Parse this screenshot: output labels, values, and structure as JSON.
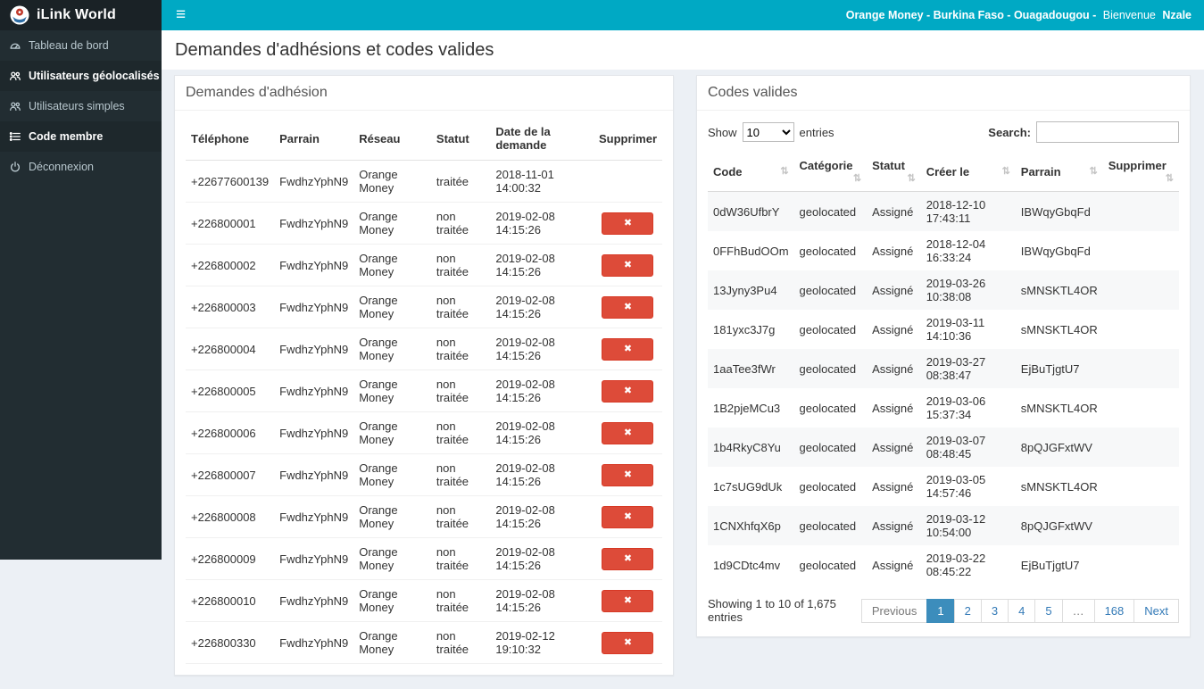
{
  "topbar": {
    "brand": "iLink World",
    "menu_icon": "≡",
    "context": "Orange Money - Burkina Faso - Ouagadougou -",
    "greeting": "Bienvenue",
    "username": "Nzale"
  },
  "sidebar": {
    "items": [
      {
        "label": "Tableau de bord",
        "icon": "dashboard-icon",
        "active": false
      },
      {
        "label": "Utilisateurs géolocalisés",
        "icon": "users-icon",
        "active": true
      },
      {
        "label": "Utilisateurs simples",
        "icon": "users-icon",
        "active": false
      },
      {
        "label": "Code membre",
        "icon": "list-icon",
        "active": true
      },
      {
        "label": "Déconnexion",
        "icon": "power-icon",
        "active": false
      }
    ]
  },
  "page": {
    "title": "Demandes d'adhésions et codes valides"
  },
  "icons": {
    "sort_icon": "⇅",
    "delete_icon": "✖"
  },
  "colors": {
    "topbar": "#00a9c4",
    "sidebar": "#222d32",
    "danger": "#dd4b39",
    "pagination_active": "#3c8dbc"
  },
  "requests_panel": {
    "title": "Demandes d'adhésion",
    "columns": [
      "Téléphone",
      "Parrain",
      "Réseau",
      "Statut",
      "Date de la demande",
      "Supprimer"
    ],
    "rows": [
      {
        "phone": "+22677600139",
        "sponsor": "FwdhzYphN9",
        "network": "Orange Money",
        "status": "traitée",
        "date": "2018-11-01 14:00:32",
        "deletable": false
      },
      {
        "phone": "+226800001",
        "sponsor": "FwdhzYphN9",
        "network": "Orange Money",
        "status": "non traitée",
        "date": "2019-02-08 14:15:26",
        "deletable": true
      },
      {
        "phone": "+226800002",
        "sponsor": "FwdhzYphN9",
        "network": "Orange Money",
        "status": "non traitée",
        "date": "2019-02-08 14:15:26",
        "deletable": true
      },
      {
        "phone": "+226800003",
        "sponsor": "FwdhzYphN9",
        "network": "Orange Money",
        "status": "non traitée",
        "date": "2019-02-08 14:15:26",
        "deletable": true
      },
      {
        "phone": "+226800004",
        "sponsor": "FwdhzYphN9",
        "network": "Orange Money",
        "status": "non traitée",
        "date": "2019-02-08 14:15:26",
        "deletable": true
      },
      {
        "phone": "+226800005",
        "sponsor": "FwdhzYphN9",
        "network": "Orange Money",
        "status": "non traitée",
        "date": "2019-02-08 14:15:26",
        "deletable": true
      },
      {
        "phone": "+226800006",
        "sponsor": "FwdhzYphN9",
        "network": "Orange Money",
        "status": "non traitée",
        "date": "2019-02-08 14:15:26",
        "deletable": true
      },
      {
        "phone": "+226800007",
        "sponsor": "FwdhzYphN9",
        "network": "Orange Money",
        "status": "non traitée",
        "date": "2019-02-08 14:15:26",
        "deletable": true
      },
      {
        "phone": "+226800008",
        "sponsor": "FwdhzYphN9",
        "network": "Orange Money",
        "status": "non traitée",
        "date": "2019-02-08 14:15:26",
        "deletable": true
      },
      {
        "phone": "+226800009",
        "sponsor": "FwdhzYphN9",
        "network": "Orange Money",
        "status": "non traitée",
        "date": "2019-02-08 14:15:26",
        "deletable": true
      },
      {
        "phone": "+226800010",
        "sponsor": "FwdhzYphN9",
        "network": "Orange Money",
        "status": "non traitée",
        "date": "2019-02-08 14:15:26",
        "deletable": true
      },
      {
        "phone": "+226800330",
        "sponsor": "FwdhzYphN9",
        "network": "Orange Money",
        "status": "non traitée",
        "date": "2019-02-12 19:10:32",
        "deletable": true
      }
    ]
  },
  "codes_panel": {
    "title": "Codes valides",
    "show_label": "Show",
    "page_size": "10",
    "entries_label": "entries",
    "search_label": "Search:",
    "columns": [
      "Code",
      "Catégorie",
      "Statut",
      "Créer le",
      "Parrain",
      "Supprimer"
    ],
    "rows": [
      {
        "code": "0dW36UfbrY",
        "category": "geolocated",
        "status": "Assigné",
        "created": "2018-12-10 17:43:11",
        "sponsor": "IBWqyGbqFd"
      },
      {
        "code": "0FFhBudOOm",
        "category": "geolocated",
        "status": "Assigné",
        "created": "2018-12-04 16:33:24",
        "sponsor": "IBWqyGbqFd"
      },
      {
        "code": "13Jyny3Pu4",
        "category": "geolocated",
        "status": "Assigné",
        "created": "2019-03-26 10:38:08",
        "sponsor": "sMNSKTL4OR"
      },
      {
        "code": "181yxc3J7g",
        "category": "geolocated",
        "status": "Assigné",
        "created": "2019-03-11 14:10:36",
        "sponsor": "sMNSKTL4OR"
      },
      {
        "code": "1aaTee3fWr",
        "category": "geolocated",
        "status": "Assigné",
        "created": "2019-03-27 08:38:47",
        "sponsor": "EjBuTjgtU7"
      },
      {
        "code": "1B2pjeMCu3",
        "category": "geolocated",
        "status": "Assigné",
        "created": "2019-03-06 15:37:34",
        "sponsor": "sMNSKTL4OR"
      },
      {
        "code": "1b4RkyC8Yu",
        "category": "geolocated",
        "status": "Assigné",
        "created": "2019-03-07 08:48:45",
        "sponsor": "8pQJGFxtWV"
      },
      {
        "code": "1c7sUG9dUk",
        "category": "geolocated",
        "status": "Assigné",
        "created": "2019-03-05 14:57:46",
        "sponsor": "sMNSKTL4OR"
      },
      {
        "code": "1CNXhfqX6p",
        "category": "geolocated",
        "status": "Assigné",
        "created": "2019-03-12 10:54:00",
        "sponsor": "8pQJGFxtWV"
      },
      {
        "code": "1d9CDtc4mv",
        "category": "geolocated",
        "status": "Assigné",
        "created": "2019-03-22 08:45:22",
        "sponsor": "EjBuTjgtU7"
      }
    ],
    "footer": "Showing 1 to 10 of 1,675 entries",
    "pagination": [
      {
        "label": "Previous",
        "name": "previous-page-button",
        "state": "disabled"
      },
      {
        "label": "1",
        "name": "page-1-button",
        "state": "active"
      },
      {
        "label": "2",
        "name": "page-2-button",
        "state": "normal"
      },
      {
        "label": "3",
        "name": "page-3-button",
        "state": "normal"
      },
      {
        "label": "4",
        "name": "page-4-button",
        "state": "normal"
      },
      {
        "label": "5",
        "name": "page-5-button",
        "state": "normal"
      },
      {
        "label": "…",
        "name": "pagination-ellipsis",
        "state": "disabled"
      },
      {
        "label": "168",
        "name": "page-168-button",
        "state": "normal"
      },
      {
        "label": "Next",
        "name": "next-page-button",
        "state": "normal"
      }
    ]
  }
}
